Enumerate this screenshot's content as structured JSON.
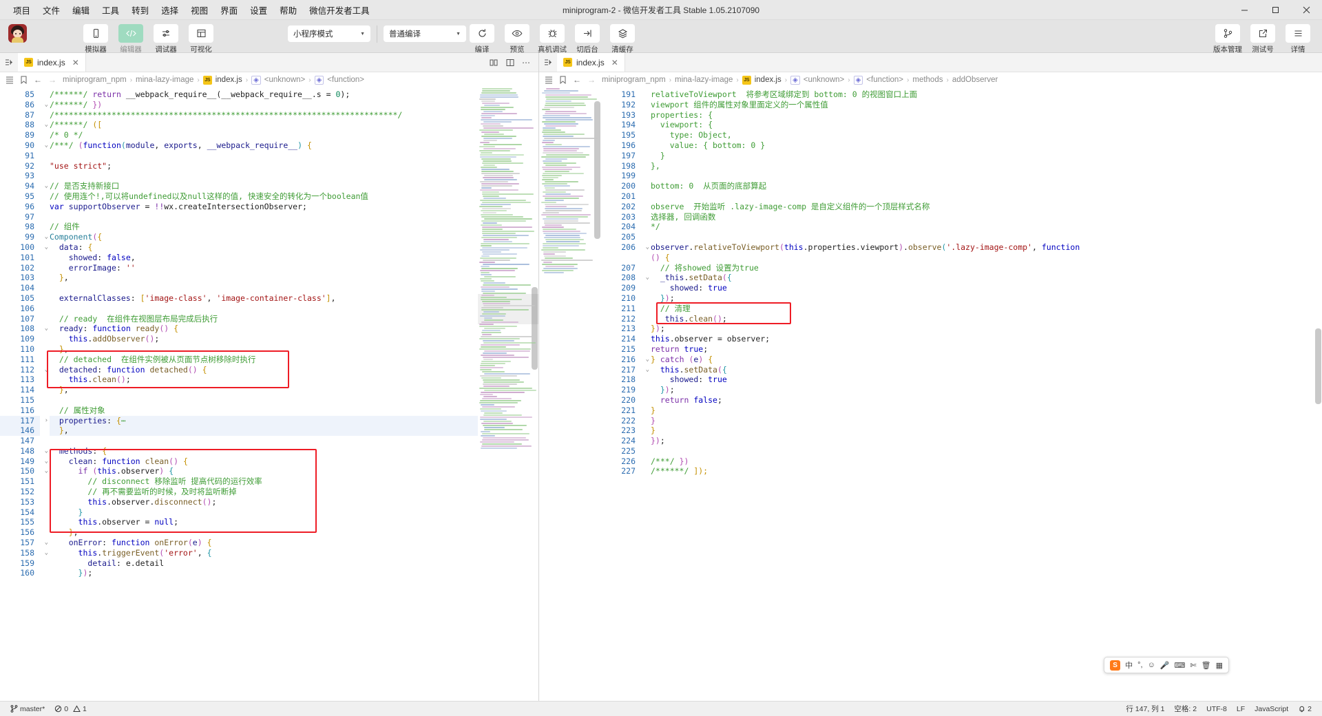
{
  "titlebar": {
    "menus": [
      "项目",
      "文件",
      "编辑",
      "工具",
      "转到",
      "选择",
      "视图",
      "界面",
      "设置",
      "帮助",
      "微信开发者工具"
    ],
    "title": "miniprogram-2 - 微信开发者工具 Stable 1.05.2107090",
    "minimize": "—",
    "maximize": "❐",
    "close": "✕"
  },
  "toolbar": {
    "left_items": [
      {
        "label": "模拟器",
        "icon": "phone-icon",
        "active": false
      },
      {
        "label": "编辑器",
        "icon": "code-icon",
        "active": true
      },
      {
        "label": "调试器",
        "icon": "sliders-icon",
        "active": false
      },
      {
        "label": "可视化",
        "icon": "layout-icon",
        "active": false
      }
    ],
    "mode_select": "小程序模式",
    "compile_select": "普通编译",
    "center_items": [
      {
        "label": "编译",
        "icon": "refresh-icon"
      },
      {
        "label": "预览",
        "icon": "eye-icon"
      },
      {
        "label": "真机调试",
        "icon": "bug-icon"
      },
      {
        "label": "切后台",
        "icon": "background-icon"
      },
      {
        "label": "清缓存",
        "icon": "layers-icon"
      }
    ],
    "right_items": [
      {
        "label": "版本管理",
        "icon": "branch-icon"
      },
      {
        "label": "测试号",
        "icon": "external-link-icon"
      },
      {
        "label": "详情",
        "icon": "menu-icon"
      }
    ]
  },
  "left_pane": {
    "tab": {
      "name": "index.js",
      "badge": "JS"
    },
    "breadcrumb": [
      "miniprogram_npm",
      "mina-lazy-image",
      "index.js",
      "<unknown>",
      "<function>"
    ],
    "lines": [
      {
        "n": 85,
        "fold": "",
        "html": "<span class='cmt'>/******/</span> <span class='kw2'>return</span> <span class='plain'>__webpack_require__(__webpack_require__.s = </span><span class='num'>0</span><span class='plain'>);</span>"
      },
      {
        "n": 86,
        "fold": "⌄",
        "html": "<span class='cmt'>/******/</span> <span class='br2'>})</span>"
      },
      {
        "n": 87,
        "fold": "",
        "html": "<span class='cmt'>/************************************************************************/</span>"
      },
      {
        "n": 88,
        "fold": "⌄",
        "html": "<span class='cmt'>/******/</span> <span class='br1'>([</span>"
      },
      {
        "n": 89,
        "fold": "",
        "html": "<span class='cmt'>/* 0 */</span>"
      },
      {
        "n": 90,
        "fold": "⌄",
        "html": "<span class='cmt'>/***/</span> <span class='br2'>(</span><span class='kw'>function</span><span class='br3'>(</span><span class='var'>module</span><span class='plain'>, </span><span class='var'>exports</span><span class='plain'>, </span><span class='var'>__webpack_require__</span><span class='br3'>)</span> <span class='br1'>{</span>"
      },
      {
        "n": 91,
        "fold": "",
        "html": ""
      },
      {
        "n": 92,
        "fold": "",
        "html": "<span class='str'>\"use strict\"</span><span class='plain'>;</span>"
      },
      {
        "n": 93,
        "fold": "",
        "html": ""
      },
      {
        "n": 94,
        "fold": "⌄",
        "html": "<span class='cmt'>// 是否支持新接口</span>"
      },
      {
        "n": 95,
        "fold": "",
        "html": "<span class='cmt'>// 使用连个!,可以将undefined以及null这样的值, 快速安全的转化为一个boolean值</span>"
      },
      {
        "n": 96,
        "fold": "",
        "html": "<span class='kw'>var</span> <span class='var'>supportObserver</span> <span class='plain'>=</span> <span class='kw2'>!!</span><span class='plain'>wx.createIntersectionObserver;</span>"
      },
      {
        "n": 97,
        "fold": "",
        "html": ""
      },
      {
        "n": 98,
        "fold": "",
        "html": "<span class='cmt'>// 组件</span>"
      },
      {
        "n": 99,
        "fold": "⌄",
        "html": "<span class='typ'>Component</span><span class='br2'>(</span><span class='br1'>{</span>"
      },
      {
        "n": 100,
        "fold": "⌄",
        "html": "  <span class='var'>data</span><span class='plain'>:</span> <span class='br1'>{</span>"
      },
      {
        "n": 101,
        "fold": "",
        "html": "    <span class='var'>showed</span><span class='plain'>:</span> <span class='kw'>false</span><span class='plain'>,</span>"
      },
      {
        "n": 102,
        "fold": "",
        "html": "    <span class='var'>errorImage</span><span class='plain'>:</span> <span class='str'>''</span>"
      },
      {
        "n": 103,
        "fold": "",
        "html": "  <span class='br1'>}</span><span class='plain'>,</span>"
      },
      {
        "n": 104,
        "fold": "",
        "html": ""
      },
      {
        "n": 105,
        "fold": "",
        "html": "  <span class='var'>externalClasses</span><span class='plain'>:</span> <span class='br1'>[</span><span class='str'>'image-class'</span><span class='plain'>,</span> <span class='str'>'image-container-class'</span><span class='br1'>]</span><span class='plain'>,</span>"
      },
      {
        "n": 106,
        "fold": "",
        "html": ""
      },
      {
        "n": 107,
        "fold": "",
        "html": "  <span class='cmt'>// ready  在组件在视图层布局完成后执行</span>"
      },
      {
        "n": 108,
        "fold": "⌄",
        "html": "  <span class='var'>ready</span><span class='plain'>:</span> <span class='kw'>function</span> <span class='fn'>ready</span><span class='br2'>()</span> <span class='br1'>{</span>"
      },
      {
        "n": 109,
        "fold": "",
        "html": "    <span class='kw'>this</span><span class='plain'>.</span><span class='fn'>addObserver</span><span class='br2'>()</span><span class='plain'>;</span>"
      },
      {
        "n": 110,
        "fold": "",
        "html": "  <span class='br1'>}</span><span class='plain'>,</span>"
      },
      {
        "n": 111,
        "fold": "",
        "html": "  <span class='cmt'>// detached  在组件实例被从页面节点树移除时执行</span>"
      },
      {
        "n": 112,
        "fold": "⌄",
        "html": "  <span class='var'>detached</span><span class='plain'>:</span> <span class='kw'>function</span> <span class='fn'>detached</span><span class='br2'>()</span> <span class='br1'>{</span>"
      },
      {
        "n": 113,
        "fold": "",
        "html": "    <span class='kw'>this</span><span class='plain'>.</span><span class='fn'>clean</span><span class='br2'>()</span><span class='plain'>;</span>"
      },
      {
        "n": 114,
        "fold": "",
        "html": "  <span class='br1'>}</span><span class='plain'>,</span>"
      },
      {
        "n": 115,
        "fold": "",
        "html": ""
      },
      {
        "n": 116,
        "fold": "",
        "html": "  <span class='cmt'>// 属性对象</span>"
      },
      {
        "n": 117,
        "fold": "›",
        "html": "  <span class='var'>properties</span><span class='plain'>:</span> <span class='br1'>{</span><span class='cmt'>⋯</span>"
      },
      {
        "n": 146,
        "fold": "",
        "html": "  <span class='br1'>}</span><span class='plain'>,</span>"
      },
      {
        "n": 147,
        "fold": "",
        "html": ""
      },
      {
        "n": 148,
        "fold": "⌄",
        "html": "  <span class='var'>methods</span><span class='plain'>:</span> <span class='br1'>{</span>"
      },
      {
        "n": 149,
        "fold": "⌄",
        "html": "    <span class='var'>clean</span><span class='plain'>:</span> <span class='kw'>function</span> <span class='fn'>clean</span><span class='br2'>()</span> <span class='br1'>{</span>"
      },
      {
        "n": 150,
        "fold": "⌄",
        "html": "      <span class='kw2'>if</span> <span class='br2'>(</span><span class='kw'>this</span><span class='plain'>.observer</span><span class='br2'>)</span> <span class='br3'>{</span>"
      },
      {
        "n": 151,
        "fold": "",
        "html": "        <span class='cmt'>// disconnect 移除监听 提高代码的运行效率</span>"
      },
      {
        "n": 152,
        "fold": "",
        "html": "        <span class='cmt'>// 再不需要监听的时候，及时将监听断掉</span>"
      },
      {
        "n": 153,
        "fold": "",
        "html": "        <span class='kw'>this</span><span class='plain'>.observer.</span><span class='fn'>disconnect</span><span class='br2'>()</span><span class='plain'>;</span>"
      },
      {
        "n": 154,
        "fold": "",
        "html": "      <span class='br3'>}</span>"
      },
      {
        "n": 155,
        "fold": "",
        "html": "      <span class='kw'>this</span><span class='plain'>.observer =</span> <span class='kw'>null</span><span class='plain'>;</span>"
      },
      {
        "n": 156,
        "fold": "",
        "html": "    <span class='br1'>}</span><span class='plain'>,</span>"
      },
      {
        "n": 157,
        "fold": "⌄",
        "html": "    <span class='var'>onError</span><span class='plain'>:</span> <span class='kw'>function</span> <span class='fn'>onError</span><span class='br2'>(</span><span class='var'>e</span><span class='br2'>)</span> <span class='br1'>{</span>"
      },
      {
        "n": 158,
        "fold": "⌄",
        "html": "      <span class='kw'>this</span><span class='plain'>.</span><span class='fn'>triggerEvent</span><span class='br2'>(</span><span class='str'>'error'</span><span class='plain'>,</span> <span class='br3'>{</span>"
      },
      {
        "n": 159,
        "fold": "",
        "html": "        <span class='var'>detail</span><span class='plain'>:</span> <span class='plain'>e.detail</span>"
      },
      {
        "n": 160,
        "fold": "",
        "html": "      <span class='br3'>}</span><span class='br2'>)</span><span class='plain'>;</span>"
      }
    ]
  },
  "right_pane": {
    "tab": {
      "name": "index.js",
      "badge": "JS"
    },
    "breadcrumb": [
      "miniprogram_npm",
      "mina-lazy-image",
      "index.js",
      "<unknown>",
      "<function>",
      "methods",
      "addObserver"
    ],
    "lines": [
      {
        "n": 191,
        "fold": "",
        "html": "<span class='cmt'>relativeToViewport  将参考区域绑定到 bottom: 0 的视图窗口上面</span>"
      },
      {
        "n": 192,
        "fold": "",
        "html": "<span class='cmt'>viewport 组件的属性对象里面定义的一个属性值</span>"
      },
      {
        "n": 193,
        "fold": "",
        "html": "<span class='cmt'>properties: {</span>"
      },
      {
        "n": 194,
        "fold": "",
        "html": "<span class='cmt'>  viewport: {</span>"
      },
      {
        "n": 195,
        "fold": "",
        "html": "<span class='cmt'>    type: Object,</span>"
      },
      {
        "n": 196,
        "fold": "",
        "html": "<span class='cmt'>    value: { bottom: 0 }</span>"
      },
      {
        "n": 197,
        "fold": "",
        "html": "<span class='cmt'>  }</span>"
      },
      {
        "n": 198,
        "fold": "",
        "html": "<span class='cmt'>},</span>"
      },
      {
        "n": 199,
        "fold": "",
        "html": ""
      },
      {
        "n": 200,
        "fold": "",
        "html": "<span class='cmt'>bottom: 0  从页面的底部算起</span>"
      },
      {
        "n": 201,
        "fold": "",
        "html": ""
      },
      {
        "n": 202,
        "fold": "",
        "html": "<span class='cmt'>observe  开始监听 .lazy-image-comp 是自定义组件的一个顶层样式名称</span>"
      },
      {
        "n": 203,
        "fold": "",
        "html": "<span class='cmt'>选择器, 回调函数</span>"
      },
      {
        "n": 204,
        "fold": "",
        "html": "<span class='cmt'>*/</span>"
      },
      {
        "n": 205,
        "fold": "",
        "html": ""
      },
      {
        "n": 206,
        "fold": "⌄",
        "html": "<span class='var'>observer</span><span class='plain'>.</span><span class='fn'>relativeToViewport</span><span class='br2'>(</span><span class='kw'>this</span><span class='plain'>.properties.viewport</span><span class='br2'>)</span><span class='plain'>.</span><span class='fn'>observe</span><span class='br3'>(</span><span class='str'>'.lazy-image-comp'</span><span class='plain'>,</span> <span class='kw'>function</span>"
      },
      {
        "n": "",
        "fold": "",
        "html": "<span class='br2'>()</span> <span class='br1'>{</span>"
      },
      {
        "n": 207,
        "fold": "",
        "html": "  <span class='cmt'>// 将showed 设置为true</span>"
      },
      {
        "n": 208,
        "fold": "⌄",
        "html": "  <span class='var'>_this</span><span class='plain'>.</span><span class='fn'>setData</span><span class='br2'>(</span><span class='br3'>{</span>"
      },
      {
        "n": 209,
        "fold": "",
        "html": "    <span class='var'>showed</span><span class='plain'>:</span> <span class='kw'>true</span>"
      },
      {
        "n": 210,
        "fold": "",
        "html": "  <span class='br3'>}</span><span class='br2'>)</span><span class='plain'>;</span>"
      },
      {
        "n": 211,
        "fold": "",
        "html": "  <span class='cmt'>// 清理</span>"
      },
      {
        "n": 212,
        "fold": "",
        "html": "  <span class='var'>_this</span><span class='plain'>.</span><span class='fn'>clean</span><span class='br2'>()</span><span class='plain'>;</span>"
      },
      {
        "n": 213,
        "fold": "",
        "html": "<span class='br1'>}</span><span class='br2'>)</span><span class='plain'>;</span>"
      },
      {
        "n": 214,
        "fold": "",
        "html": "<span class='kw'>this</span><span class='plain'>.observer = observer;</span>"
      },
      {
        "n": 215,
        "fold": "",
        "html": "<span class='kw2'>return</span> <span class='kw'>true</span><span class='plain'>;</span>"
      },
      {
        "n": 216,
        "fold": "⌄",
        "html": "<span class='br1'>}</span> <span class='kw2'>catch</span> <span class='br2'>(</span><span class='var'>e</span><span class='br2'>)</span> <span class='br1'>{</span>"
      },
      {
        "n": 217,
        "fold": "⌄",
        "html": "  <span class='kw'>this</span><span class='plain'>.</span><span class='fn'>setData</span><span class='br2'>(</span><span class='br3'>{</span>"
      },
      {
        "n": 218,
        "fold": "",
        "html": "    <span class='var'>showed</span><span class='plain'>:</span> <span class='kw'>true</span>"
      },
      {
        "n": 219,
        "fold": "",
        "html": "  <span class='br3'>}</span><span class='br2'>)</span><span class='plain'>;</span>"
      },
      {
        "n": 220,
        "fold": "",
        "html": "  <span class='kw2'>return</span> <span class='kw'>false</span><span class='plain'>;</span>"
      },
      {
        "n": 221,
        "fold": "",
        "html": "<span class='br1'>}</span>"
      },
      {
        "n": 222,
        "fold": "",
        "html": "<span class='br2'>}</span>"
      },
      {
        "n": 223,
        "fold": "",
        "html": "<span class='br1'>}</span>"
      },
      {
        "n": 224,
        "fold": "",
        "html": "<span class='br2'>})</span><span class='plain'>;</span>"
      },
      {
        "n": 225,
        "fold": "",
        "html": ""
      },
      {
        "n": 226,
        "fold": "",
        "html": "<span class='cmt'>/***/</span> <span class='br2'>})</span>"
      },
      {
        "n": 227,
        "fold": "",
        "html": "<span class='cmt'>/******/</span> <span class='br1'>]);</span>"
      }
    ]
  },
  "ime": {
    "logo": "S",
    "items": [
      "中",
      "°,",
      "☺",
      "🎤",
      "⌨",
      "✂",
      "🗑",
      "▦"
    ]
  },
  "statusbar": {
    "branch": "master*",
    "errors": "0",
    "warnings": "1",
    "position": "行 147, 列 1",
    "spaces": "空格: 2",
    "encoding": "UTF-8",
    "eol": "LF",
    "language": "JavaScript",
    "bell": "2"
  },
  "colors": {
    "accent": "#9fdbc0",
    "redbox": "#ee1c25",
    "js_badge": "#f5c518",
    "breadcrumb": "#8a8a8a"
  }
}
